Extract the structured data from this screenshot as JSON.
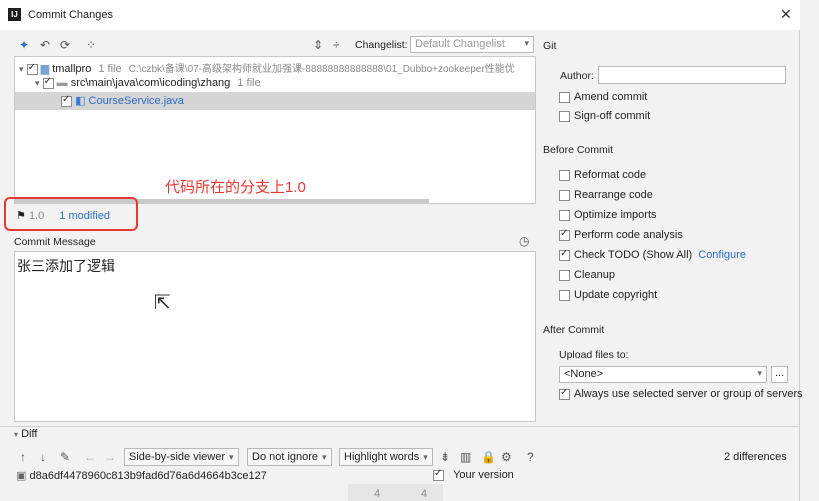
{
  "window": {
    "title": "Commit Changes",
    "app_icon": "intellij-icon",
    "close": "✕"
  },
  "toolbar": {
    "changelist_label": "Changelist:",
    "changelist_value": "Default Changelist"
  },
  "tree": {
    "root": {
      "name": "tmallpro",
      "count": "1 file",
      "path": "C:\\czbk\\备课\\07-高级架构师就业加强课-88888888888888\\01_Dubbo+zookeeper性能优"
    },
    "folder": {
      "name": "src\\main\\java\\com\\icoding\\zhang",
      "count": "1 file"
    },
    "file": {
      "name": "CourseService.java"
    }
  },
  "annotation": {
    "text": "代码所在的分支上1.0",
    "color": "#e53935"
  },
  "branch": {
    "name": "1.0",
    "modified": "1 modified"
  },
  "commit_message": {
    "label": "Commit Message",
    "text": "张三添加了逻辑"
  },
  "git": {
    "section": "Git",
    "author_label": "Author:",
    "amend": "Amend commit",
    "signoff": "Sign-off commit"
  },
  "before_commit": {
    "section": "Before Commit",
    "options": [
      {
        "label": "Reformat code",
        "checked": false
      },
      {
        "label": "Rearrange code",
        "checked": false
      },
      {
        "label": "Optimize imports",
        "checked": false
      },
      {
        "label": "Perform code analysis",
        "checked": true
      },
      {
        "label": "Check TODO (Show All)",
        "checked": true
      },
      {
        "label": "Cleanup",
        "checked": false
      },
      {
        "label": "Update copyright",
        "checked": false
      }
    ],
    "configure_link": "Configure"
  },
  "after_commit": {
    "section": "After Commit",
    "upload_label": "Upload files to:",
    "upload_value": "<None>",
    "more": "...",
    "always_use": "Always use selected server or group of servers"
  },
  "diff": {
    "section": "Diff",
    "viewer": "Side-by-side viewer",
    "ignore": "Do not ignore",
    "highlight": "Highlight words",
    "help": "?",
    "differences": "2 differences",
    "hash": "d8a6df4478960c813b9fad6d76a6d4664b3ce127",
    "your_version": "Your version",
    "line_left": "4",
    "line_right": "4"
  }
}
